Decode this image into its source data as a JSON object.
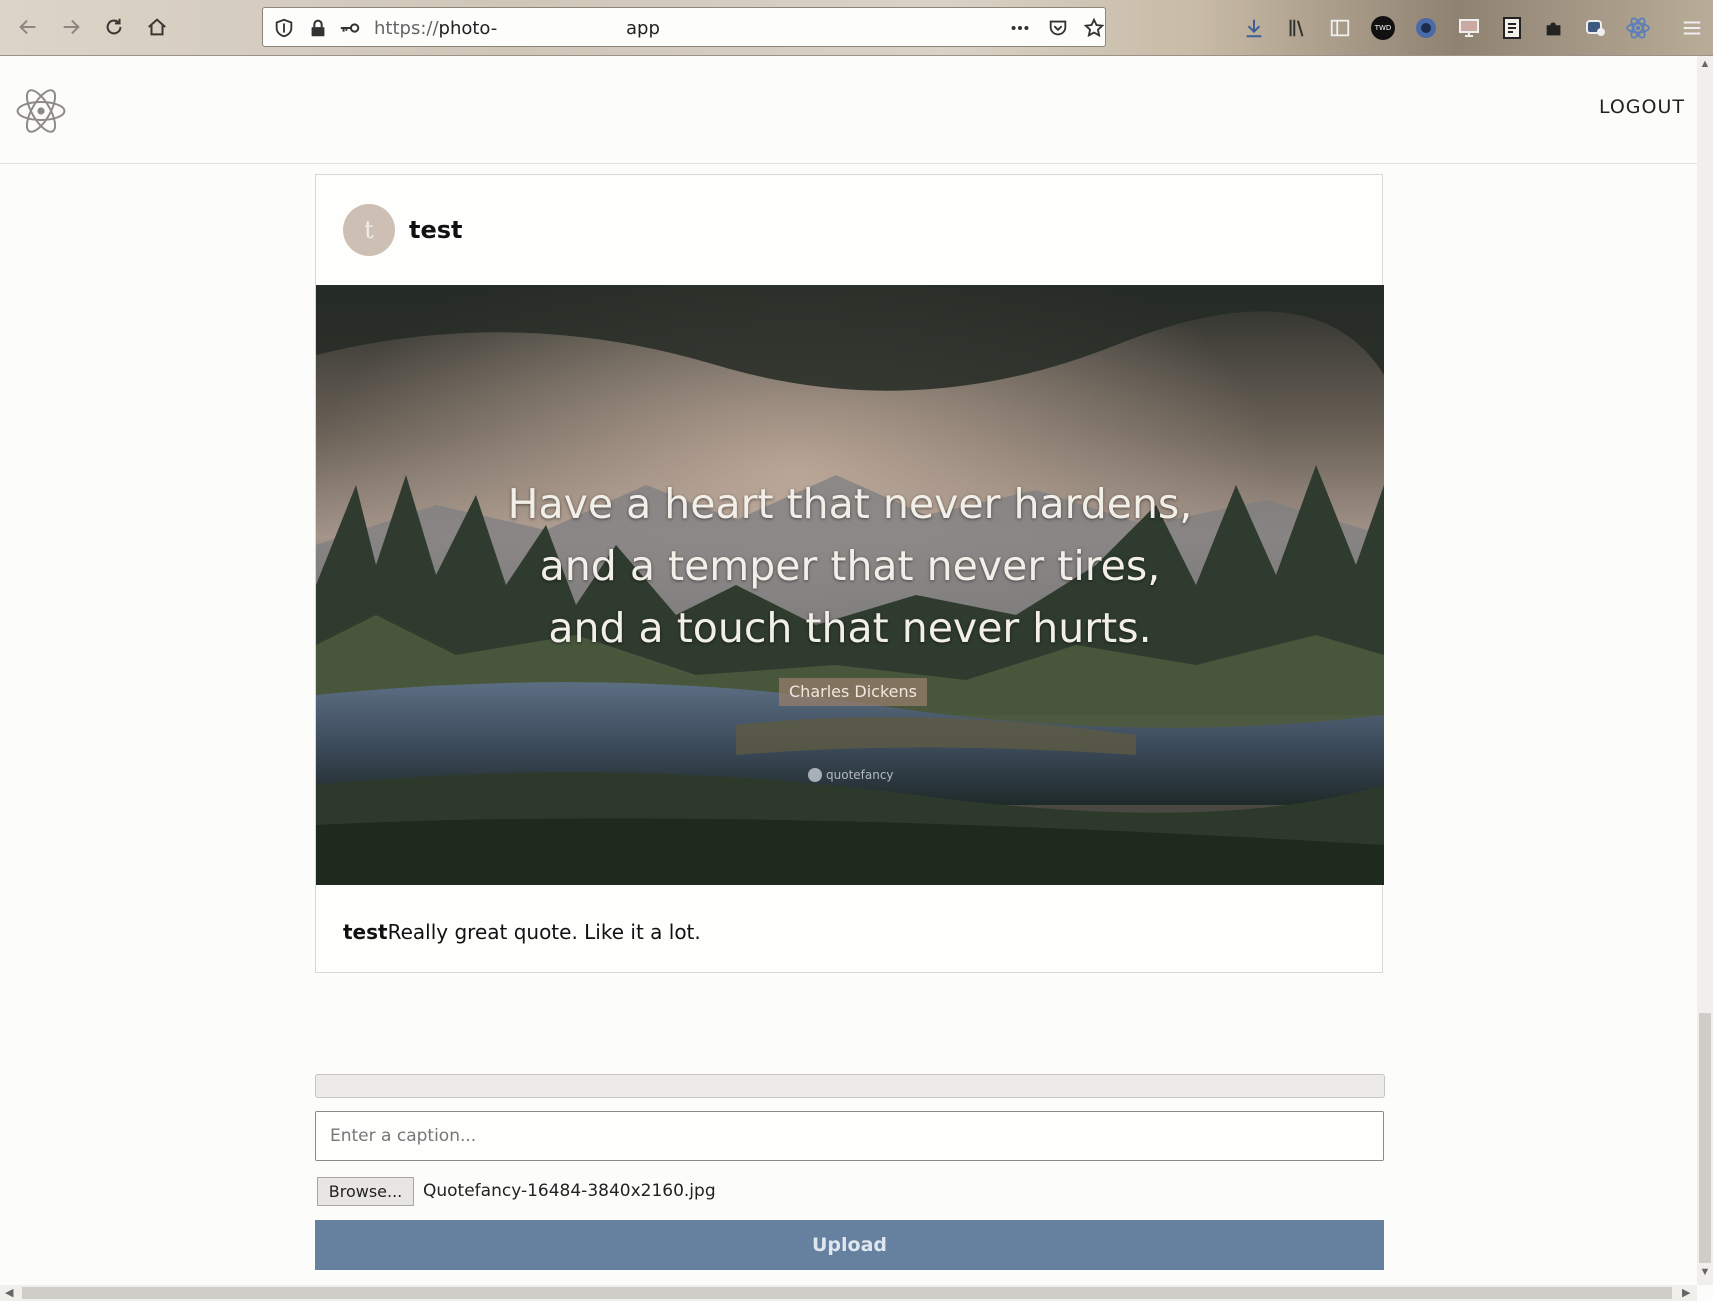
{
  "browser": {
    "url_scheme": "https://",
    "url_host": "photo-",
    "url_suffix": "app",
    "icons": [
      "back-arrow-icon",
      "forward-arrow-icon",
      "reload-icon",
      "home-icon",
      "shield-icon",
      "lock-icon",
      "key-icon",
      "more-dots-icon",
      "pocket-icon",
      "star-icon",
      "download-icon",
      "library-icon",
      "sidebar-icon",
      "twd-extension-icon",
      "extension-icon",
      "screen-icon",
      "notes-icon",
      "puzzle-icon",
      "extension-icon",
      "react-devtools-icon",
      "menu-icon"
    ],
    "twd_label": "TWD"
  },
  "header": {
    "logo_icon": "react-atom-icon",
    "logout_label": "LOGOUT"
  },
  "post": {
    "avatar_letter": "t",
    "username": "test",
    "image": {
      "quote_lines": [
        "Have a heart that never hardens,",
        "and a temper that never tires,",
        "and a touch that never hurts."
      ],
      "author": "Charles Dickens",
      "watermark": "quotefancy"
    },
    "caption_user": "test",
    "caption_text": "Really great quote. Like it a lot."
  },
  "upload": {
    "progress_percent": 0,
    "caption_placeholder": "Enter a caption...",
    "browse_label": "Browse...",
    "file_name": "Quotefancy-16484-3840x2160.jpg",
    "upload_label": "Upload"
  },
  "colors": {
    "upload_button": "#6680a0",
    "page_background": "#fcfcfa"
  }
}
